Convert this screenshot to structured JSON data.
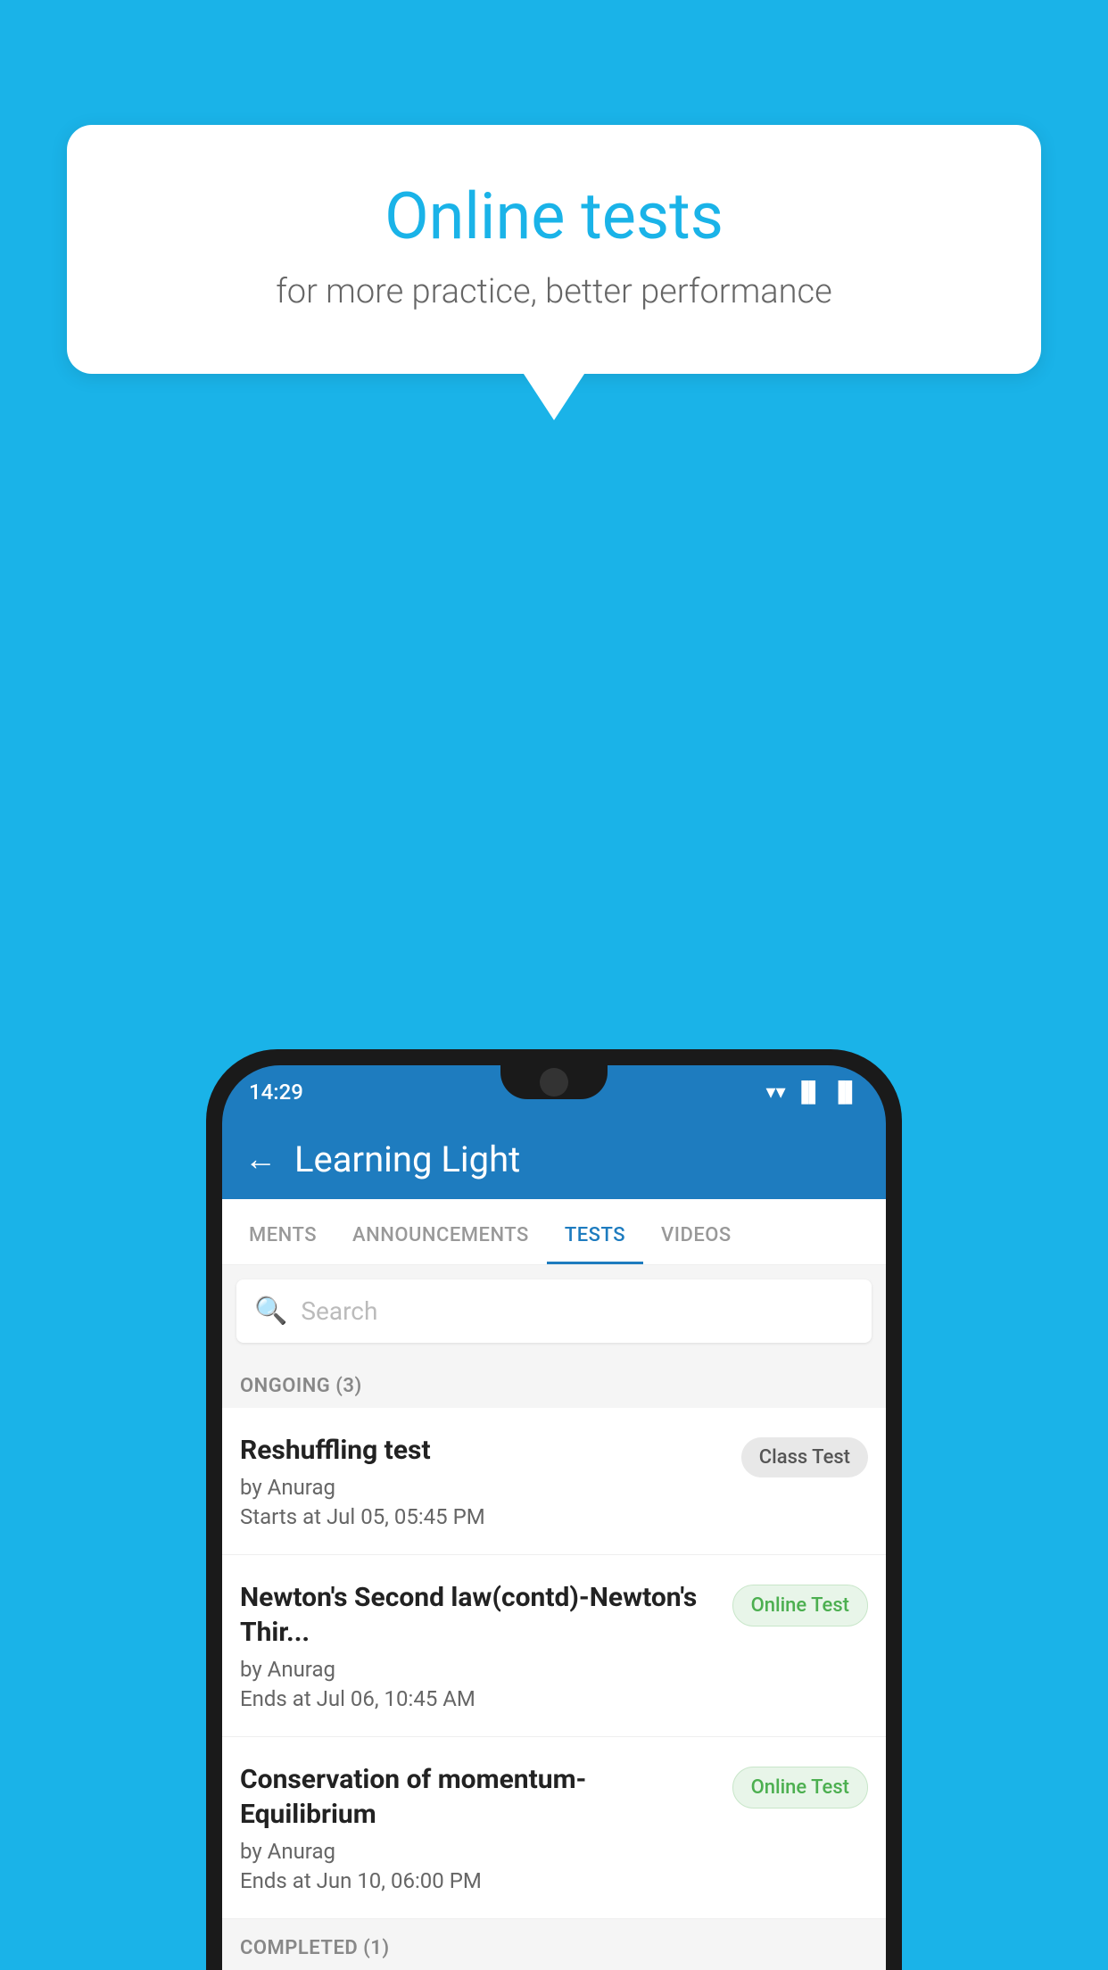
{
  "background_color": "#1ab3e8",
  "speech_bubble": {
    "title": "Online tests",
    "subtitle": "for more practice, better performance"
  },
  "phone": {
    "status_bar": {
      "time": "14:29",
      "wifi_icon": "▼",
      "signal_icon": "▲",
      "battery_icon": "▐"
    },
    "header": {
      "title": "Learning Light",
      "back_label": "←"
    },
    "tabs": [
      {
        "label": "MENTS",
        "active": false
      },
      {
        "label": "ANNOUNCEMENTS",
        "active": false
      },
      {
        "label": "TESTS",
        "active": true
      },
      {
        "label": "VIDEOS",
        "active": false
      }
    ],
    "search": {
      "placeholder": "Search"
    },
    "ongoing_section": {
      "label": "ONGOING (3)"
    },
    "tests": [
      {
        "name": "Reshuffling test",
        "author": "by Anurag",
        "time_label": "Starts at",
        "time": "Jul 05, 05:45 PM",
        "badge": "Class Test",
        "badge_type": "class"
      },
      {
        "name": "Newton's Second law(contd)-Newton's Thir...",
        "author": "by Anurag",
        "time_label": "Ends at",
        "time": "Jul 06, 10:45 AM",
        "badge": "Online Test",
        "badge_type": "online"
      },
      {
        "name": "Conservation of momentum-Equilibrium",
        "author": "by Anurag",
        "time_label": "Ends at",
        "time": "Jun 10, 06:00 PM",
        "badge": "Online Test",
        "badge_type": "online"
      }
    ],
    "completed_section": {
      "label": "COMPLETED (1)"
    }
  }
}
